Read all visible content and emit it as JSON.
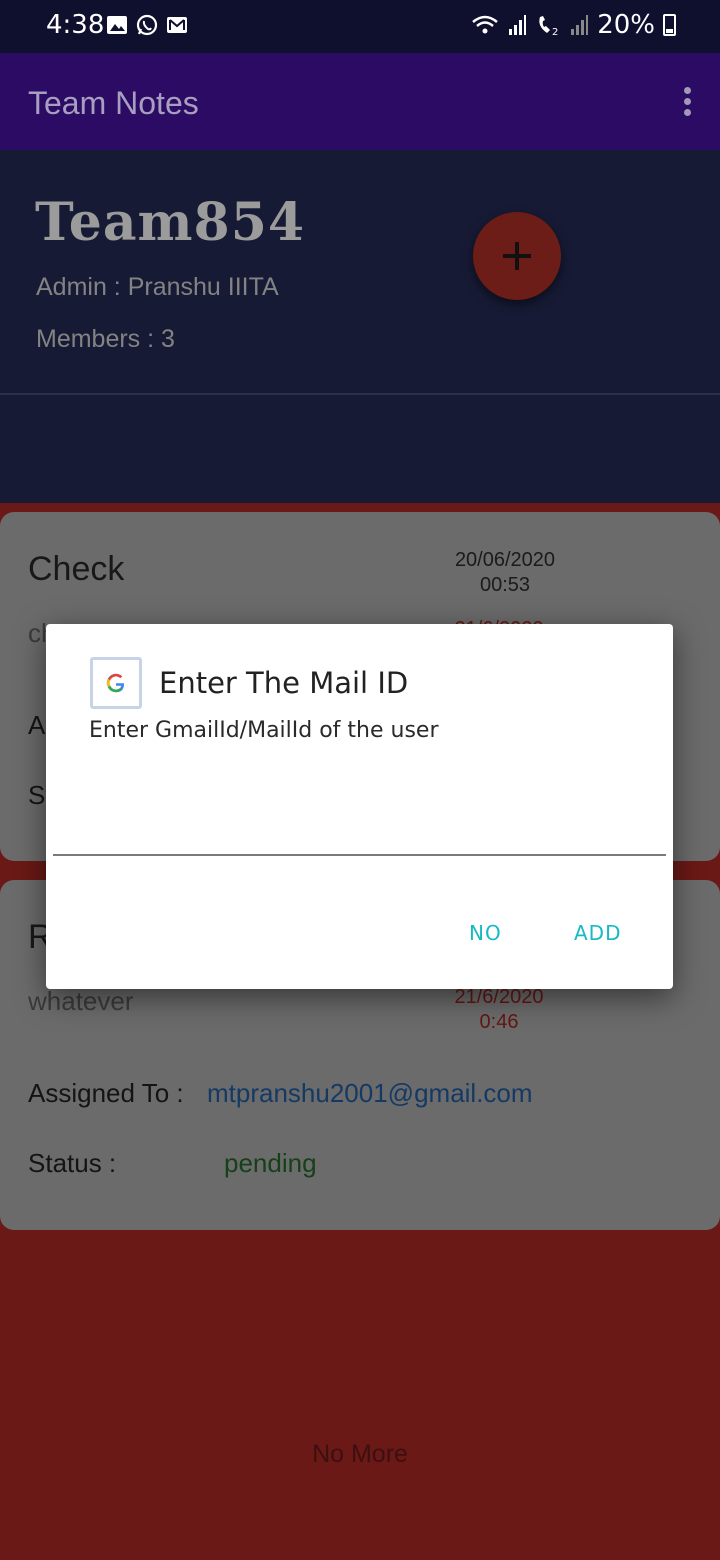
{
  "status_bar": {
    "time": "4:38",
    "battery_text": "20%",
    "left_icons": [
      "image-icon",
      "whatsapp-icon",
      "gmail-icon"
    ],
    "right_icons": [
      "wifi-icon",
      "signal-icon",
      "wifi-call-icon",
      "signal-2-icon",
      "battery-icon"
    ]
  },
  "app_bar": {
    "title": "Team Notes"
  },
  "team": {
    "name": "Team854",
    "admin": "Admin : Pranshu IIITA",
    "members": "Members : 3"
  },
  "cards": [
    {
      "title": "Check",
      "date_line1": "20/06/2020",
      "date_line2": "00:53",
      "desc_partial": "ch",
      "deadline_partial": "21/6/2020",
      "assigned_partial": "A",
      "status_partial": "St"
    },
    {
      "title_partial": "R",
      "description": "whatever",
      "deadline_line1": "21/6/2020",
      "deadline_line2": "0:46",
      "assigned_label": "Assigned To :",
      "assigned_email": "mtpranshu2001@gmail.com",
      "status_label": "Status :",
      "status_value": "pending"
    }
  ],
  "footer_text": "No More",
  "dialog": {
    "icon": "google-icon",
    "title": "Enter The Mail ID",
    "message": "Enter GmailId/MailId of the user",
    "input_value": "",
    "no_label": "NO",
    "add_label": "ADD"
  },
  "colors": {
    "app_bar": "#2b0b64",
    "header": "#161a34",
    "background": "#6a1916",
    "card": "#6b6b6b",
    "accent": "#18b9c6"
  }
}
